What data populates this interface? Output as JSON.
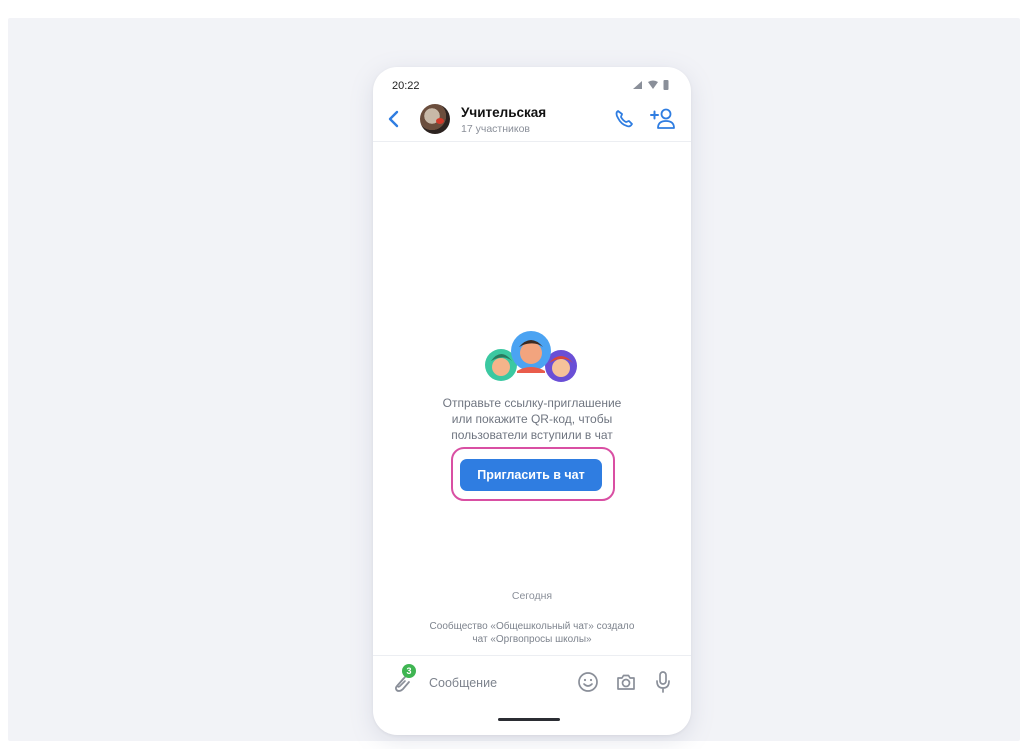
{
  "status_bar": {
    "time": "20:22"
  },
  "header": {
    "title": "Учительская",
    "subtitle": "17 участников",
    "icons": [
      "back-arrow-icon",
      "phone-icon",
      "add-user-icon"
    ]
  },
  "invite": {
    "lines": [
      "Отправьте ссылку-приглашение",
      "или покажите QR-код, чтобы",
      "пользователи вступили в чат"
    ],
    "button_label": "Пригласить в чат"
  },
  "feed": {
    "date_label": "Сегодня",
    "system_message_lines": [
      "Сообщество «Общешкольный чат» создало",
      "чат «Оргвопросы школы»"
    ]
  },
  "composer": {
    "attach_badge": "3",
    "placeholder": "Сообщение",
    "icons": [
      "paperclip-icon",
      "emoji-icon",
      "camera-icon",
      "microphone-icon"
    ]
  },
  "colors": {
    "accent": "#2f7de1",
    "highlight": "#d94fa3",
    "badge": "#3fb552",
    "background": "#f2f3f7"
  }
}
